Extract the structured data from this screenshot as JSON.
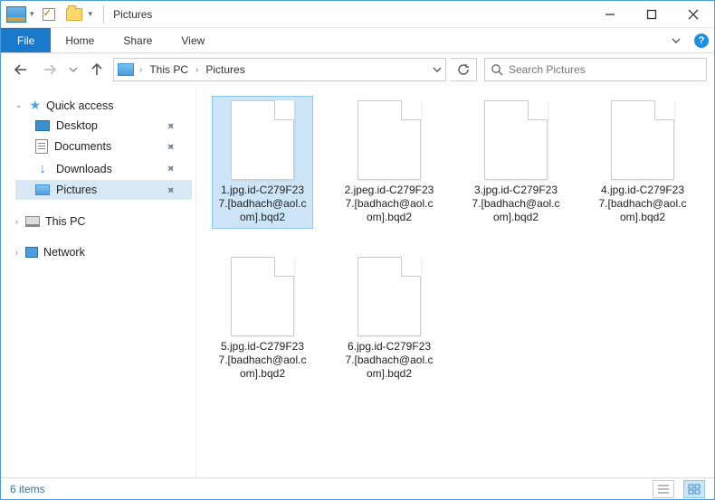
{
  "window": {
    "title": "Pictures"
  },
  "ribbon": {
    "file": "File",
    "tabs": [
      "Home",
      "Share",
      "View"
    ]
  },
  "breadcrumb": {
    "root_sep": "›",
    "items": [
      "This PC",
      "Pictures"
    ]
  },
  "search": {
    "placeholder": "Search Pictures"
  },
  "navpane": {
    "quick_access": "Quick access",
    "qa_items": [
      {
        "label": "Desktop",
        "icon": "desktop",
        "pinned": true
      },
      {
        "label": "Documents",
        "icon": "docs",
        "pinned": true
      },
      {
        "label": "Downloads",
        "icon": "down",
        "pinned": true
      },
      {
        "label": "Pictures",
        "icon": "pics",
        "pinned": true,
        "selected": true
      }
    ],
    "this_pc": "This PC",
    "network": "Network"
  },
  "files": [
    {
      "name": "1.jpg.id-C279F237.[badhach@aol.com].bqd2",
      "selected": true
    },
    {
      "name": "2.jpeg.id-C279F237.[badhach@aol.com].bqd2"
    },
    {
      "name": "3.jpg.id-C279F237.[badhach@aol.com].bqd2"
    },
    {
      "name": "4.jpg.id-C279F237.[badhach@aol.com].bqd2"
    },
    {
      "name": "5.jpg.id-C279F237.[badhach@aol.com].bqd2"
    },
    {
      "name": "6.jpg.id-C279F237.[badhach@aol.com].bqd2"
    }
  ],
  "status": {
    "count_label": "6 items"
  }
}
